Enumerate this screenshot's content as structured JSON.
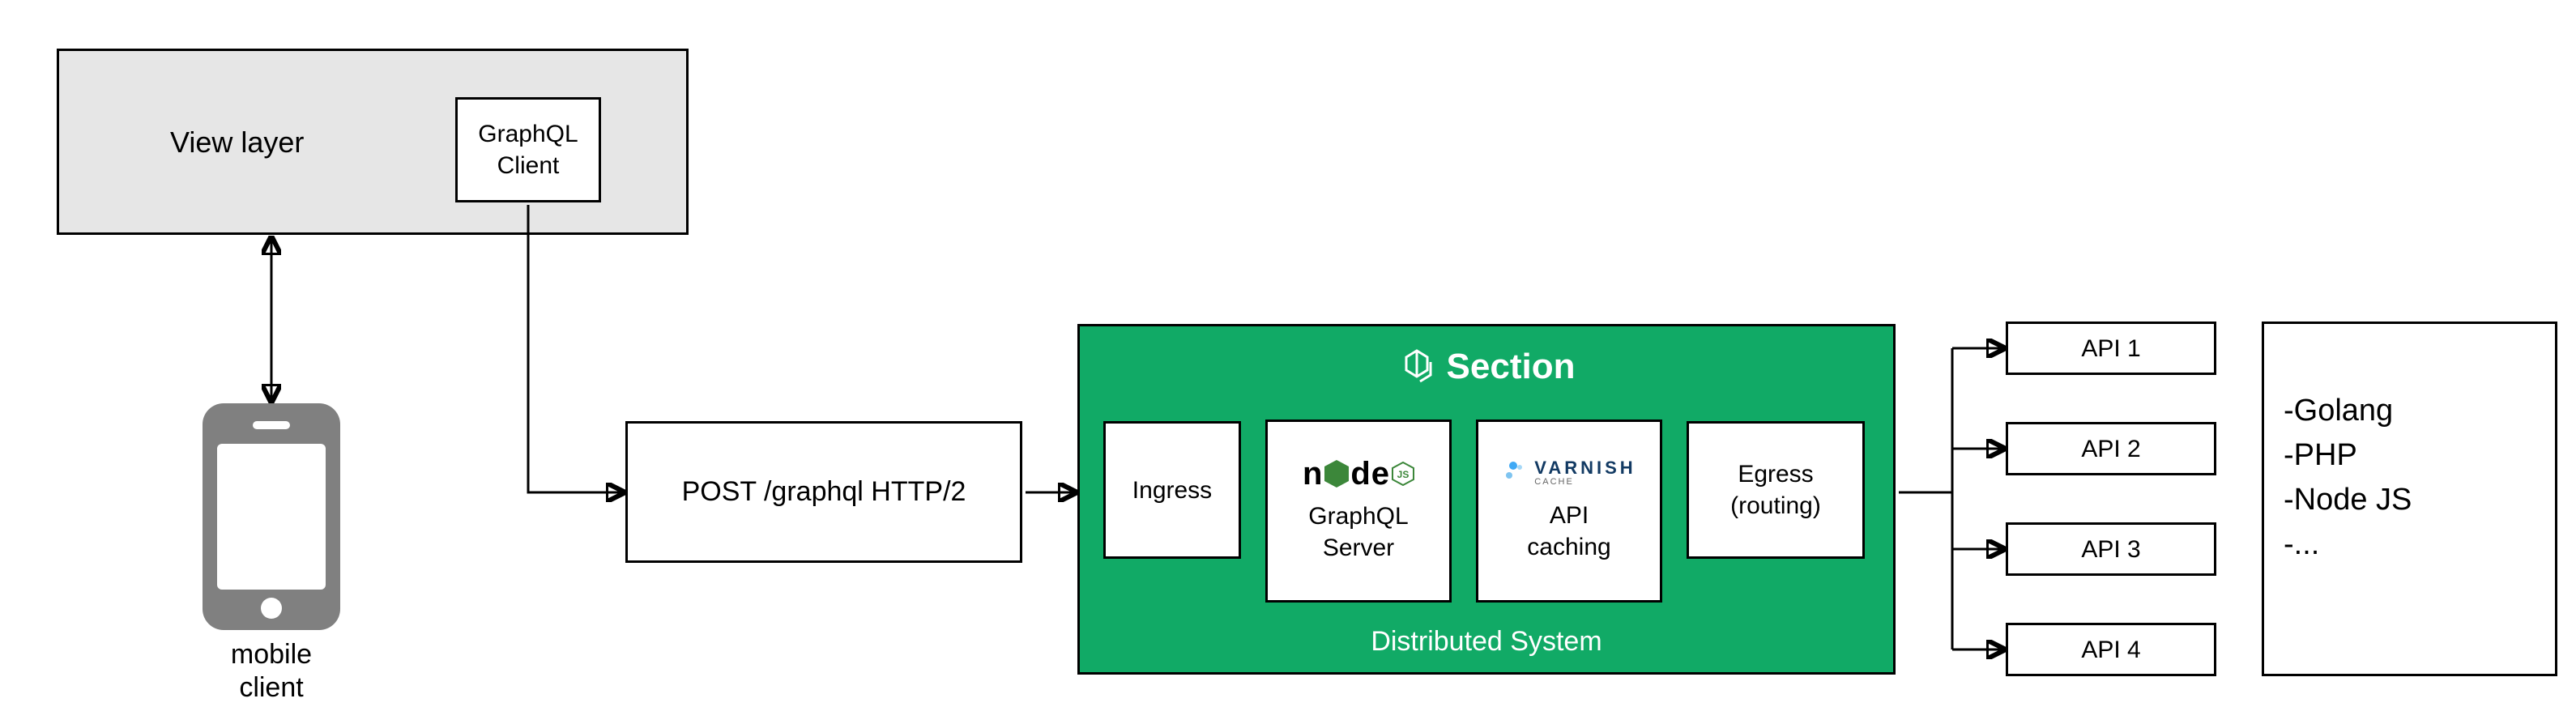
{
  "view_layer": {
    "label": "View layer"
  },
  "graphql_client": {
    "label": "GraphQL\nClient"
  },
  "mobile_client": {
    "label": "mobile\nclient"
  },
  "post_box": {
    "label": "POST /graphql HTTP/2"
  },
  "section": {
    "brand": "Section",
    "footer": "Distributed System",
    "ingress": "Ingress",
    "graphql_server_logo_left": "n",
    "graphql_server_logo_right": "de",
    "graphql_server_icon_text": "JS",
    "graphql_server_label": "GraphQL\nServer",
    "varnish_brand": "VARNISH",
    "varnish_sub": "CACHE",
    "varnish_label": "API\ncaching",
    "egress": "Egress\n(routing)"
  },
  "apis": {
    "api1": "API 1",
    "api2": "API 2",
    "api3": "API 3",
    "api4": "API 4"
  },
  "langs": {
    "l1": "-Golang",
    "l2": "-PHP",
    "l3": "-Node JS",
    "l4": "-..."
  }
}
